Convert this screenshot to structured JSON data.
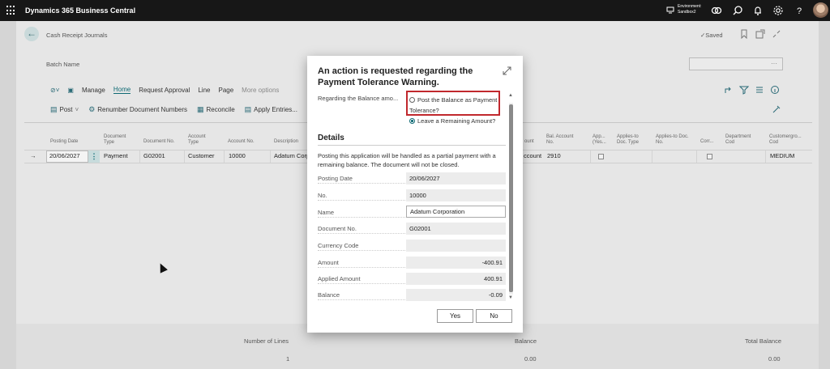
{
  "app": {
    "title": "Dynamics 365 Business Central",
    "environment_label": "Environment:",
    "environment_name": "Sandbox2"
  },
  "page": {
    "breadcrumb": "Cash Receipt Journals",
    "saved_status": "✓Saved",
    "batch_name_label": "Batch Name",
    "batch_field_more": "···"
  },
  "menu": {
    "items": [
      "Manage",
      "Home",
      "Request Approval",
      "Line",
      "Page",
      "More options"
    ],
    "active": "Home"
  },
  "actions": {
    "post": "Post",
    "renumber": "Renumber Document Numbers",
    "reconcile": "Reconcile",
    "apply_entries": "Apply Entries..."
  },
  "grid": {
    "headers": {
      "posting_date": "Posting Date",
      "document_type": [
        "Document",
        "Type"
      ],
      "document_no": "Document No.",
      "account_type": [
        "Account",
        "Type"
      ],
      "account_no": "Account No.",
      "description": "Description",
      "account_right": "ount",
      "bal_account_no": [
        "Bal. Account",
        "No."
      ],
      "approval": [
        "App...",
        "(Yes..."
      ],
      "applies_to_doc_type": [
        "Applies-to",
        "Doc. Type"
      ],
      "applies_to_doc_no": [
        "Applies-to Doc.",
        "No."
      ],
      "corr": "Corr...",
      "department_code": [
        "Department",
        "Cod"
      ],
      "customergroup_code": [
        "Customergro...",
        "Cod"
      ]
    },
    "row": {
      "arrow": "→",
      "posting_date": "20/06/2027",
      "document_type": "Payment",
      "document_no": "G02001",
      "account_type": "Customer",
      "account_no": "10000",
      "description": "Adatum Corp",
      "account_right": "ccount",
      "bal_account_no": "2910",
      "customergroup_code": "MEDIUM"
    }
  },
  "footer": {
    "number_of_lines_label": "Number of Lines",
    "number_of_lines": "1",
    "balance_label": "Balance",
    "balance": "0.00",
    "total_balance_label": "Total Balance",
    "total_balance": "0.00"
  },
  "dialog": {
    "title": "An action is requested regarding the Payment Tolerance Warning.",
    "question_label": "Regarding the Balance amo...",
    "option_post": "Post the Balance as Payment Tolerance?",
    "option_leave": "Leave a Remaining Amount?",
    "selected_option": "Leave a Remaining Amount?",
    "details_heading": "Details",
    "note": "Posting this application will be handled as a partial payment with a remaining balance. The document will not be closed.",
    "fields": {
      "posting_date": {
        "label": "Posting Date",
        "value": "20/06/2027"
      },
      "no": {
        "label": "No.",
        "value": "10000"
      },
      "name": {
        "label": "Name",
        "value": "Adatum Corporation"
      },
      "document_no": {
        "label": "Document No.",
        "value": "G02001"
      },
      "currency_code": {
        "label": "Currency Code",
        "value": ""
      },
      "amount": {
        "label": "Amount",
        "value": "-400.91"
      },
      "applied_amount": {
        "label": "Applied Amount",
        "value": "400.91"
      },
      "balance": {
        "label": "Balance",
        "value": "-0.09"
      }
    },
    "yes_label": "Yes",
    "no_label": "No"
  },
  "colors": {
    "accent": "#0f6a74",
    "highlight_box": "#c0282d",
    "topbar": "#171717"
  }
}
